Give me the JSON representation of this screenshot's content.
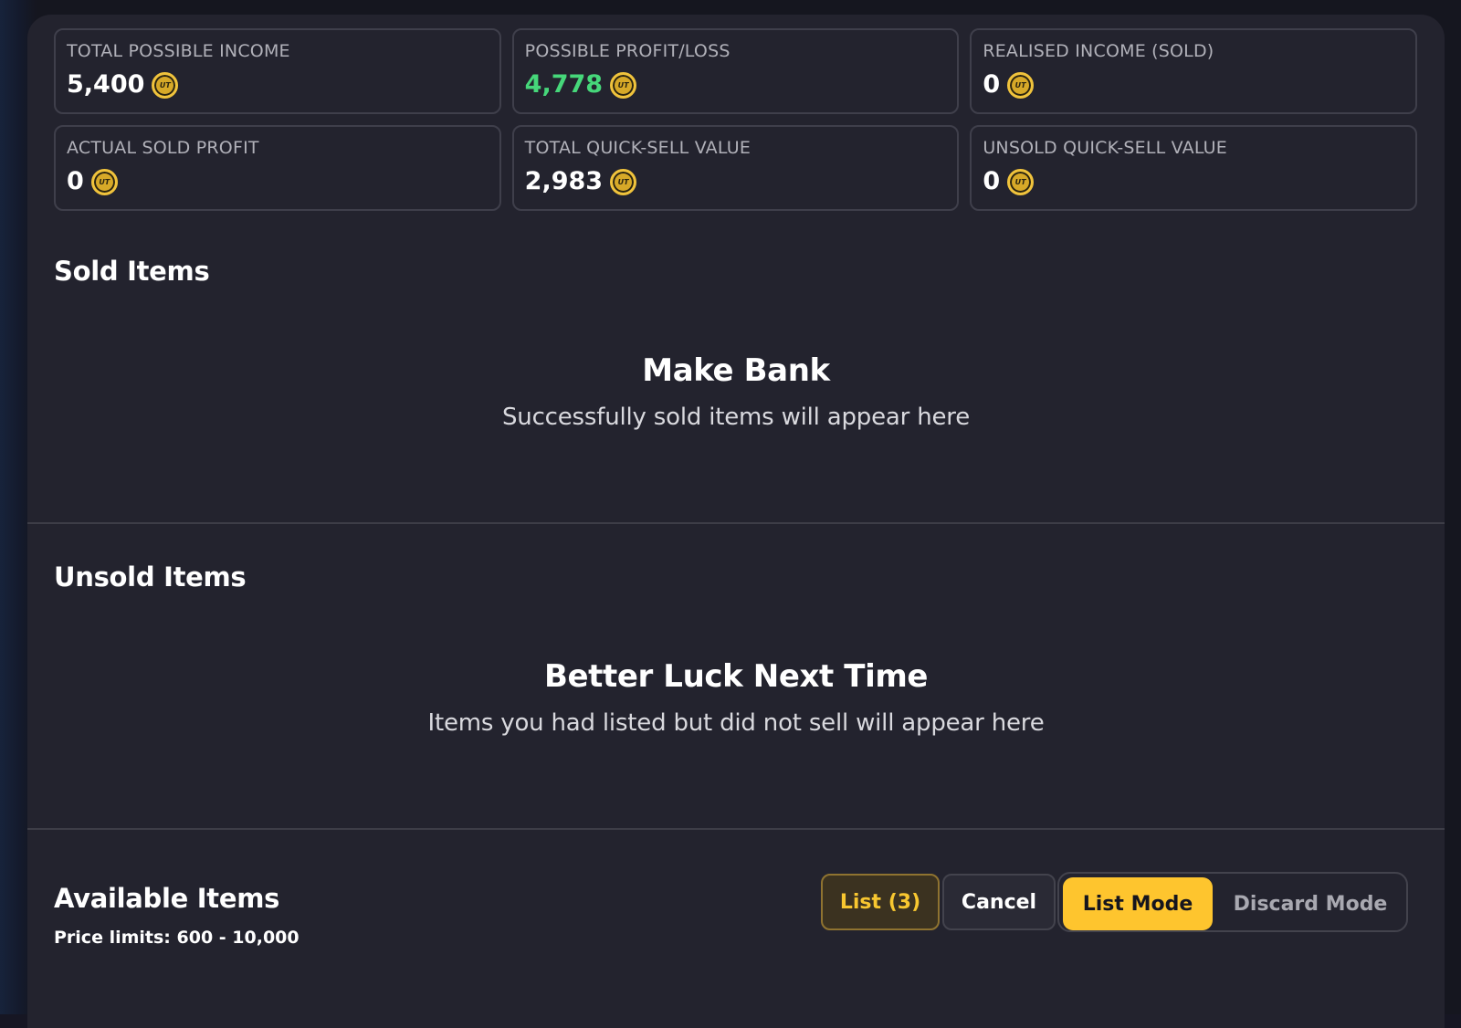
{
  "stats": [
    {
      "label": "TOTAL POSSIBLE INCOME",
      "value": "5,400"
    },
    {
      "label": "POSSIBLE PROFIT/LOSS",
      "value": "4,778"
    },
    {
      "label": "REALISED INCOME (SOLD)",
      "value": "0"
    },
    {
      "label": "ACTUAL SOLD PROFIT",
      "value": "0"
    },
    {
      "label": "TOTAL QUICK-SELL VALUE",
      "value": "2,983"
    },
    {
      "label": "UNSOLD QUICK-SELL VALUE",
      "value": "0"
    }
  ],
  "coin_glyph": "UT",
  "colors": {
    "accent": "#fec52e",
    "positive": "#46d77a",
    "panel": "#23232e"
  },
  "sold": {
    "title": "Sold Items",
    "empty_title": "Make Bank",
    "empty_subtitle": "Successfully sold items will appear here"
  },
  "unsold": {
    "title": "Unsold Items",
    "empty_title": "Better Luck Next Time",
    "empty_subtitle": "Items you had listed but did not sell will appear here"
  },
  "available": {
    "title": "Available Items",
    "price_limits": "Price limits: 600 - 10,000",
    "list_button": "List (3)",
    "cancel_button": "Cancel",
    "modes": [
      "List Mode",
      "Discard Mode"
    ],
    "active_mode": "List Mode"
  }
}
